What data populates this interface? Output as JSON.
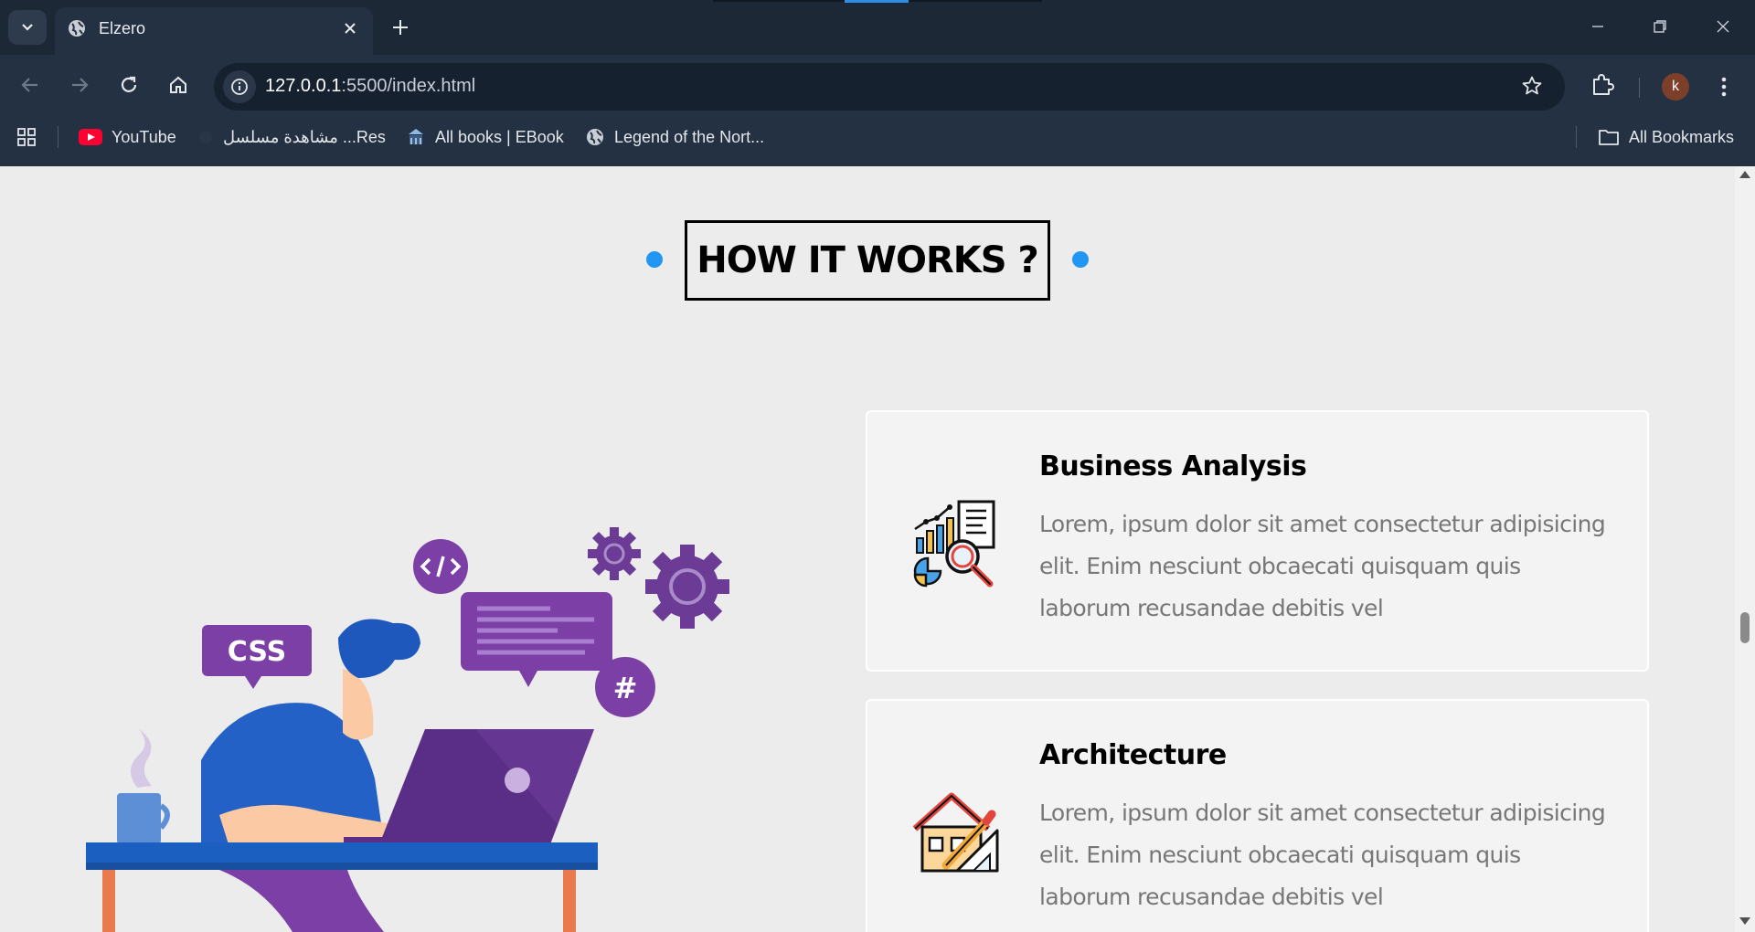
{
  "browser": {
    "tab_title": "Elzero",
    "url_host": "127.0.0.1",
    "url_path": ":5500/index.html",
    "profile_initial": "k",
    "bookmarks": [
      {
        "label": "YouTube",
        "icon": "youtube-icon"
      },
      {
        "label": "مشاهدة مسلسل ...Res",
        "icon": "blank-page-icon"
      },
      {
        "label": "All books | EBook",
        "icon": "ebook-icon"
      },
      {
        "label": "Legend of the Nort...",
        "icon": "globe-icon"
      }
    ],
    "all_bookmarks_label": "All Bookmarks"
  },
  "page": {
    "section_title": "HOW IT WORKS ?",
    "accent_color": "#2196f3",
    "illustration_badge": "CSS",
    "illustration_hash": "#",
    "cards": [
      {
        "title": "Business Analysis",
        "text": "Lorem, ipsum dolor sit amet consectetur adipisicing elit. Enim nesciunt obcaecati quisquam quis laborum recusandae debitis vel",
        "icon": "business-analysis-icon"
      },
      {
        "title": "Architecture",
        "text": "Lorem, ipsum dolor sit amet consectetur adipisicing elit. Enim nesciunt obcaecati quisquam quis laborum recusandae debitis vel",
        "icon": "architecture-icon"
      }
    ]
  }
}
